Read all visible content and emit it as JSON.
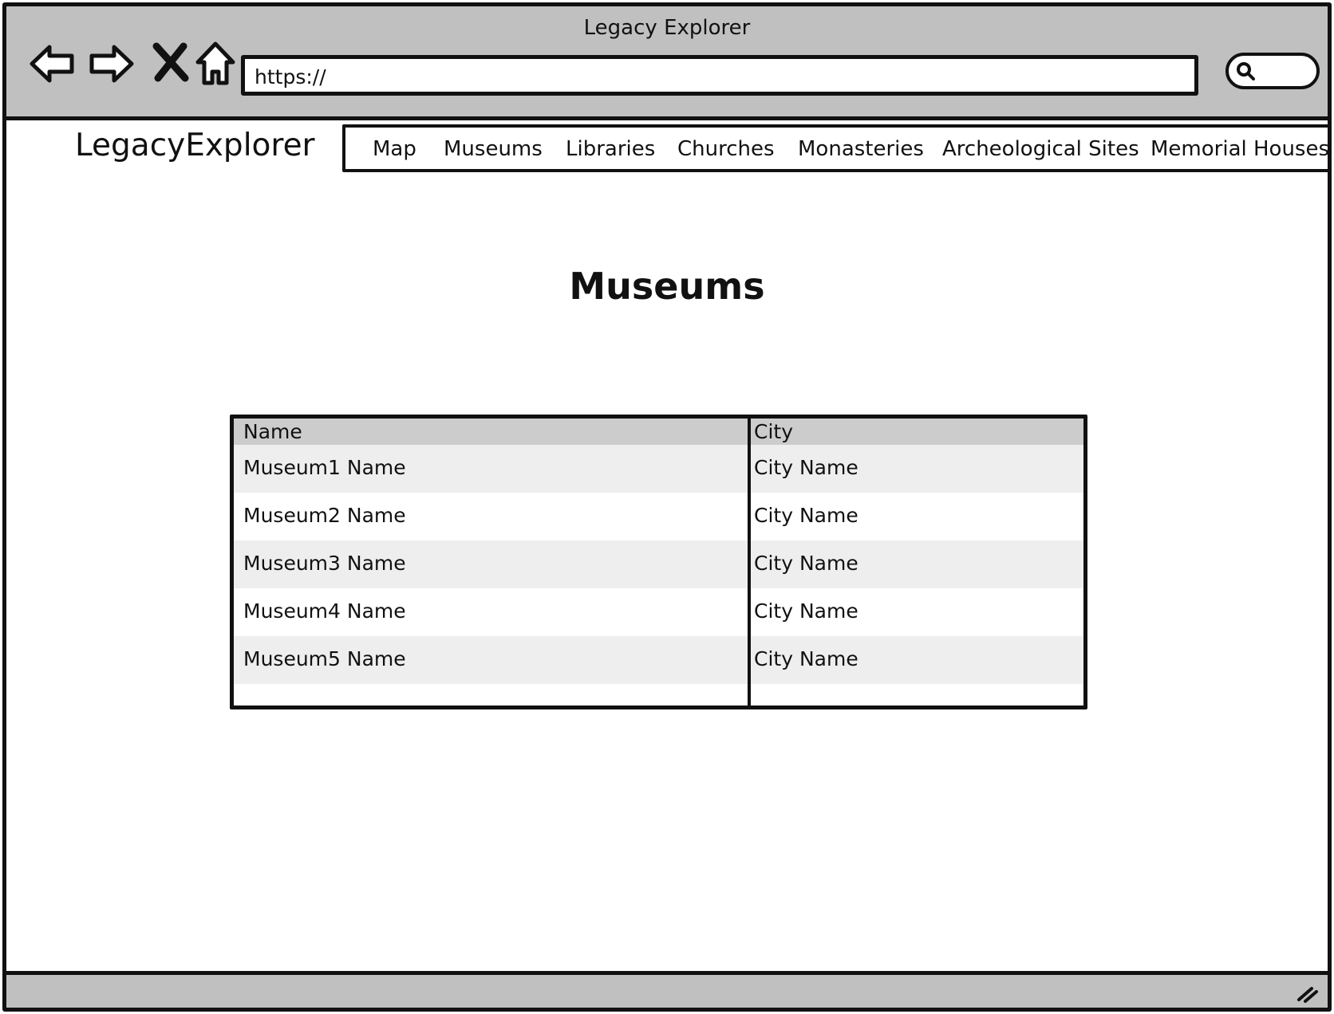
{
  "window": {
    "title": "Legacy Explorer"
  },
  "browser": {
    "back_icon": "back-arrow-icon",
    "forward_icon": "forward-arrow-icon",
    "stop_icon": "close-icon",
    "home_icon": "home-icon",
    "url": "https://",
    "search_icon": "search-icon"
  },
  "site": {
    "brand": "LegacyExplorer",
    "nav": [
      {
        "label": "Map"
      },
      {
        "label": "Museums"
      },
      {
        "label": "Libraries"
      },
      {
        "label": "Churches"
      },
      {
        "label": "Monasteries"
      },
      {
        "label": "Archeological Sites"
      },
      {
        "label": "Memorial Houses"
      }
    ]
  },
  "page": {
    "heading": "Museums"
  },
  "table": {
    "columns": [
      "Name",
      "City"
    ],
    "rows": [
      {
        "name": "Museum1 Name",
        "city": "City Name"
      },
      {
        "name": "Museum2 Name",
        "city": "City Name"
      },
      {
        "name": "Museum3 Name",
        "city": "City Name"
      },
      {
        "name": "Museum4 Name",
        "city": "City Name"
      },
      {
        "name": "Museum5 Name",
        "city": "City Name"
      }
    ]
  },
  "statusbar": {
    "resize_icon": "resize-grip-icon"
  },
  "colors": {
    "chrome": "#c0c0c0",
    "table_header": "#cccccc",
    "row_alt": "#eeeeee",
    "border": "#111111"
  }
}
